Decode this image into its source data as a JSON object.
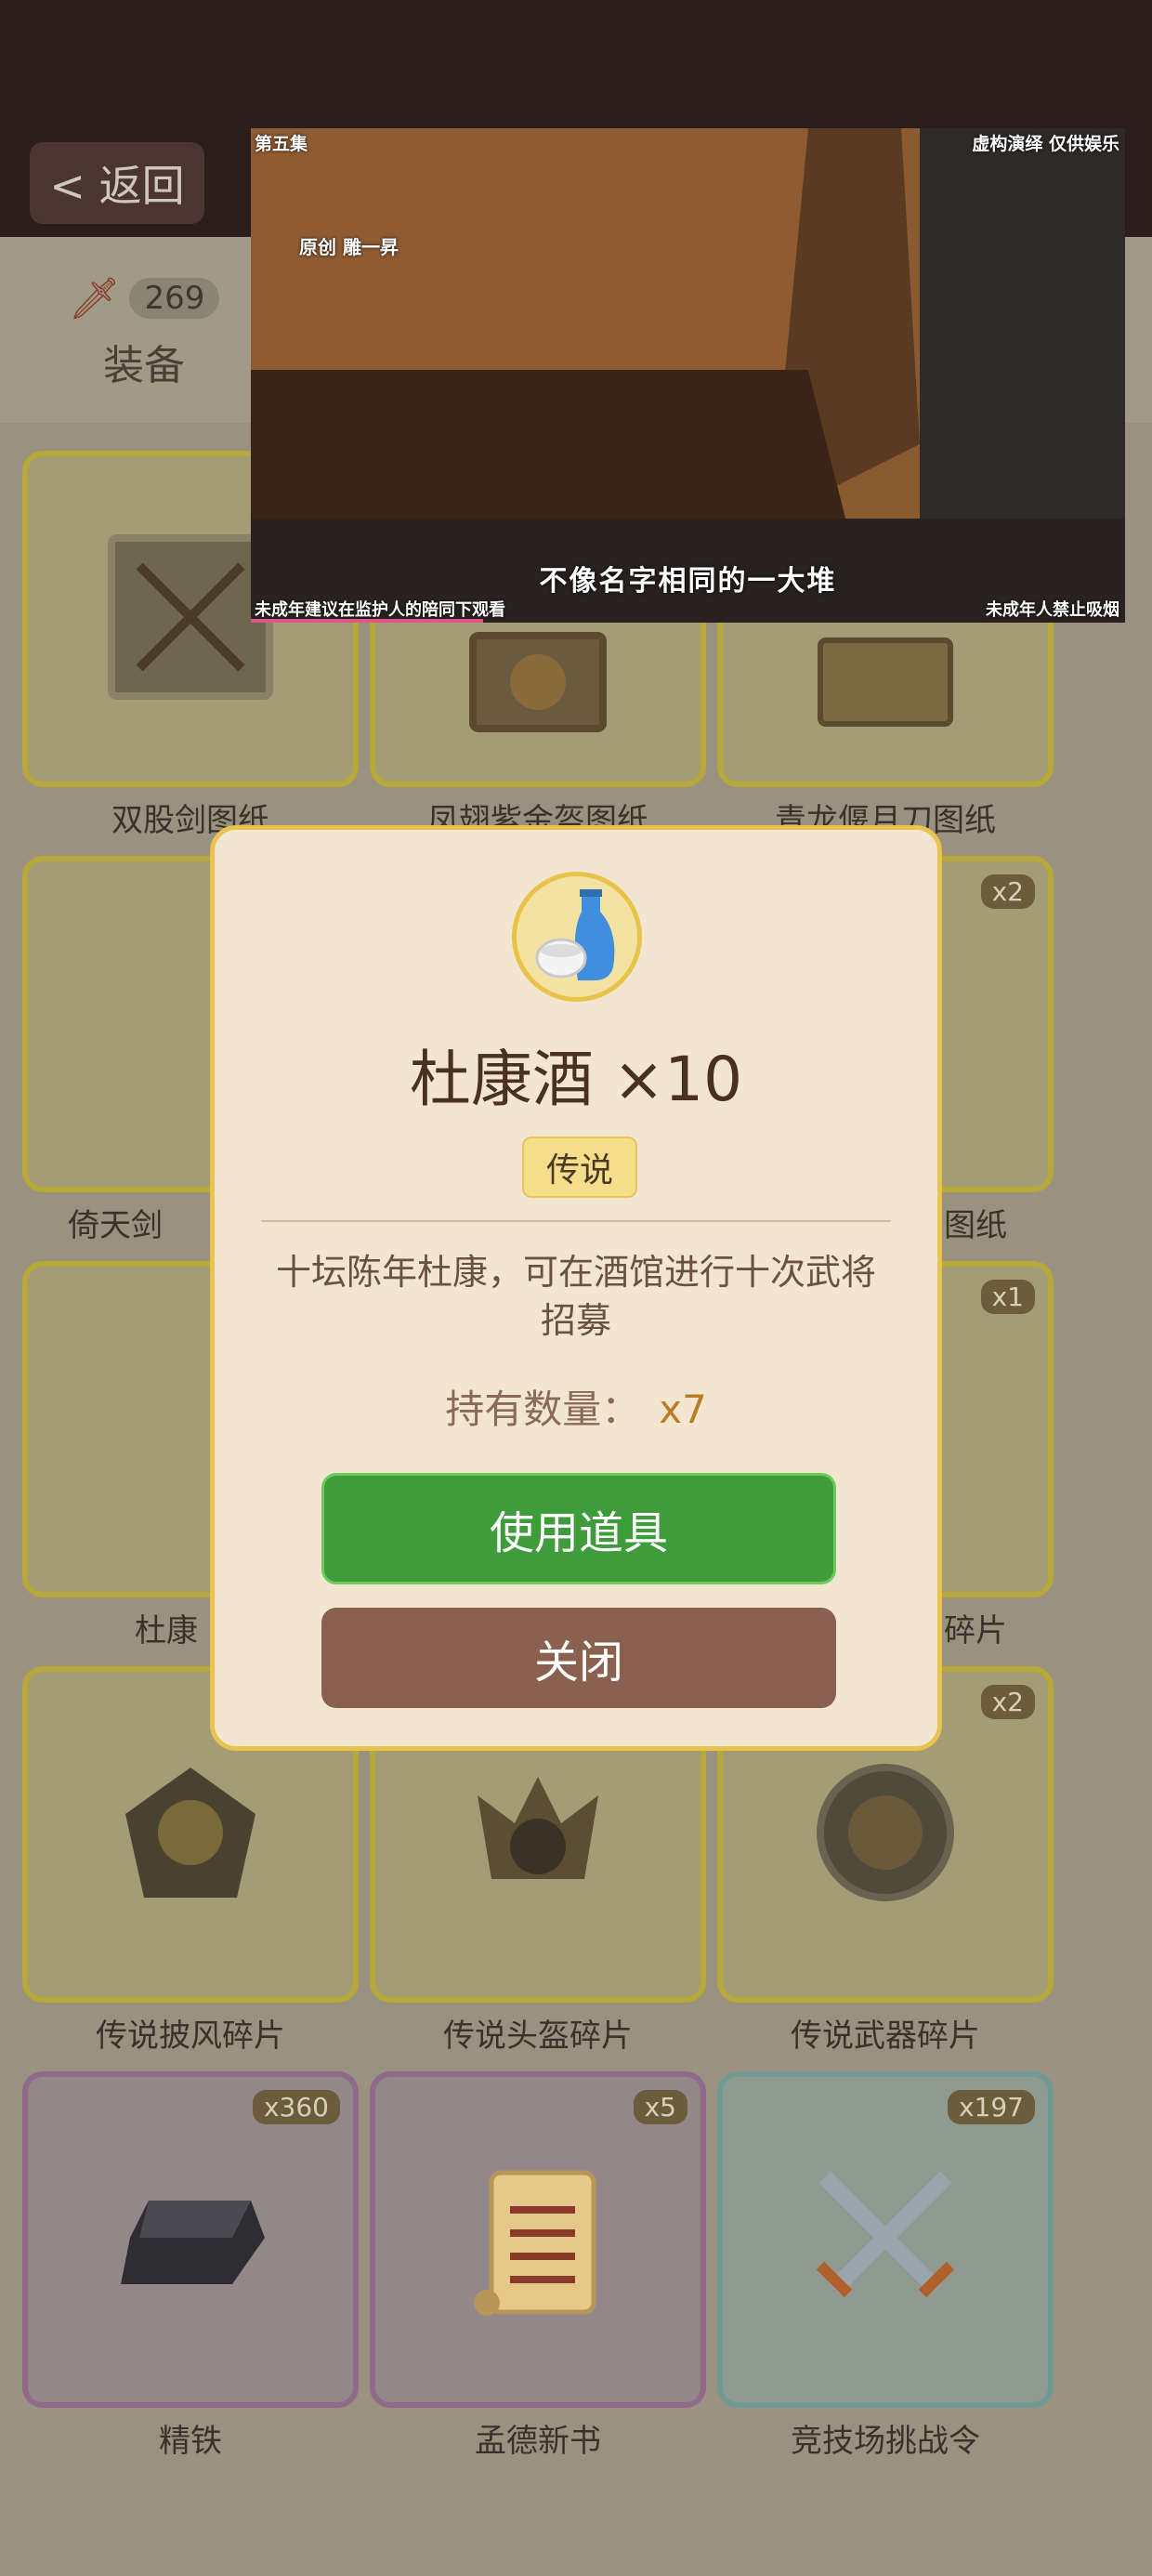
{
  "header": {
    "back_label": "< 返回"
  },
  "tabs": {
    "equip": {
      "count": "269",
      "label": "装备"
    }
  },
  "grid": [
    {
      "label": "双股剑图纸",
      "badge": ""
    },
    {
      "label": "凤翅紫金盔图纸",
      "badge": ""
    },
    {
      "label": "青龙偃月刀图纸",
      "badge": ""
    },
    {
      "label": "倚天剑",
      "badge": ""
    },
    {
      "label": "",
      "badge": ""
    },
    {
      "label": "图纸",
      "badge": "x2"
    },
    {
      "label": "杜康",
      "badge": ""
    },
    {
      "label": "",
      "badge": ""
    },
    {
      "label": "碎片",
      "badge": "x1"
    },
    {
      "label": "传说披风碎片",
      "badge": ""
    },
    {
      "label": "传说头盔碎片",
      "badge": ""
    },
    {
      "label": "传说武器碎片",
      "badge": "x2"
    },
    {
      "label": "精铁",
      "badge": "x360"
    },
    {
      "label": "孟德新书",
      "badge": "x5"
    },
    {
      "label": "竞技场挑战令",
      "badge": "x197"
    }
  ],
  "video": {
    "episode": "第五集",
    "disclaimer": "虚构演绎 仅供娱乐",
    "original": "原创 雕一昇",
    "subtitle": "不像名字相同的一大堆",
    "bottom_left": "未成年建议在监护人的陪同下观看",
    "bottom_right": "未成年人禁止吸烟"
  },
  "modal": {
    "title": "杜康酒 ×10",
    "rarity": "传说",
    "description": "十坛陈年杜康，可在酒馆进行十次武将招募",
    "own_label": "持有数量：",
    "own_value": "x7",
    "use_button": "使用道具",
    "close_button": "关闭"
  }
}
